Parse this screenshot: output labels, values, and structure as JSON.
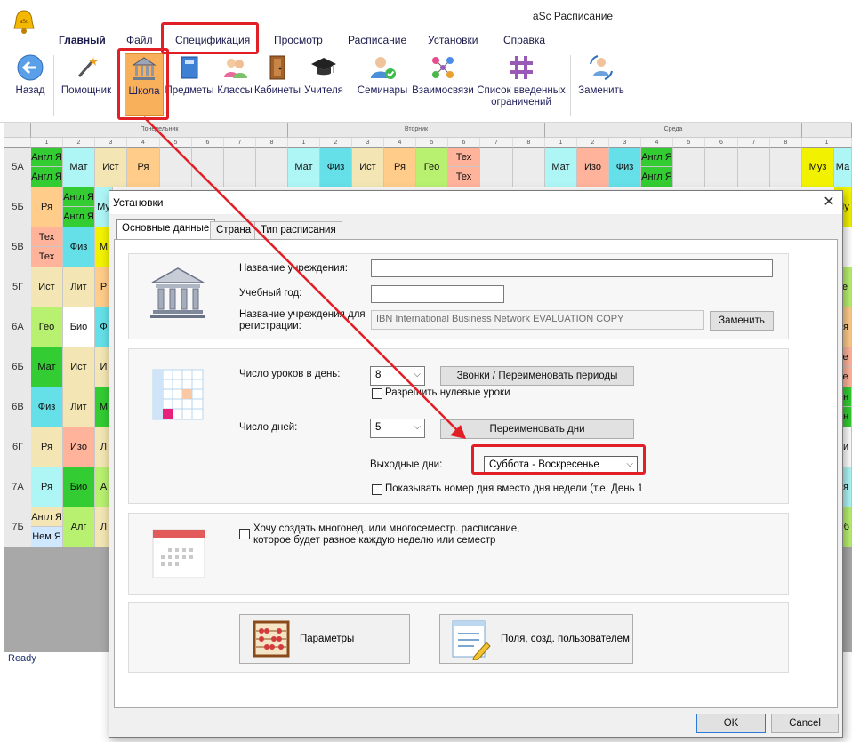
{
  "app": {
    "title": "aSc Расписание",
    "status": "Ready"
  },
  "menu": [
    "Главный",
    "Файл",
    "Спецификация",
    "Просмотр",
    "Расписание",
    "Установки",
    "Справка"
  ],
  "ribbon": {
    "back": "Назад",
    "wizard": "Помощник",
    "school": "Школа",
    "subjects": "Предметы",
    "classes": "Классы",
    "rooms": "Кабинеты",
    "teachers": "Учителя",
    "seminars": "Семинары",
    "relations": "Взаимосвязи",
    "constraints": "Список введенных ограничений",
    "replace": "Заменить"
  },
  "grid": {
    "days": [
      "Понедельник",
      "Вторник",
      "Среда"
    ],
    "periods": [
      "1",
      "2",
      "3",
      "4",
      "5",
      "6",
      "7",
      "8"
    ],
    "classes": [
      "5А",
      "5Б",
      "5В",
      "5Г",
      "6А",
      "6Б",
      "6В",
      "6Г",
      "7А",
      "7Б"
    ]
  },
  "lessons": {
    "r0": [
      "Англ Я",
      "Англ Я",
      "Мат",
      "Ист",
      "Ря",
      "Мат",
      "Физ",
      "Ист",
      "Ря",
      "Гео",
      "Тех",
      "Тех",
      "Мат",
      "Изо",
      "Физ",
      "Англ Я",
      "Англ Я",
      "Муз",
      "Ма"
    ],
    "r1": [
      "Ря",
      "Англ Я",
      "Англ Я",
      "Му",
      "Му"
    ],
    "r2": [
      "Тех",
      "Тех",
      "Физ",
      "М"
    ],
    "r3": [
      "Ист",
      "Лит",
      "Р",
      "Ге"
    ],
    "r4": [
      "Гео",
      "Био",
      "Ф",
      "Ря"
    ],
    "r5": [
      "Мат",
      "Ист",
      "И",
      "Те",
      "Те"
    ],
    "r6": [
      "Физ",
      "Лит",
      "М",
      "Ан",
      "Ан"
    ],
    "r7": [
      "Ря",
      "Изо",
      "Л",
      "Би"
    ],
    "r8": [
      "Ря",
      "Био",
      "А",
      "Ря"
    ],
    "r9": [
      "Англ Я",
      "Нем Я",
      "Алг",
      "Л",
      "Об"
    ]
  },
  "dialog": {
    "title": "Установки",
    "tabs": [
      "Основные данные",
      "Страна",
      "Тип расписания"
    ],
    "org_name_label": "Название учреждения:",
    "org_name_value": "",
    "year_label": "Учебный год:",
    "year_value": "",
    "reg_name_label": "Название учреждения для регистрации:",
    "reg_name_value": "IBN International Business Network EVALUATION COPY",
    "replace_button": "Заменить",
    "lessons_per_day_label": "Число уроков в день:",
    "lessons_per_day_value": "8",
    "bells_button": "Звонки / Переименовать периоды",
    "zero_lessons_label": "Разрешить нулевые уроки",
    "days_label": "Число дней:",
    "days_value": "5",
    "rename_days_button": "Переименовать дни",
    "weekend_label": "Выходные дни:",
    "weekend_value": "Суббота - Воскресенье",
    "show_day_number_label": "Показывать номер дня вместо дня недели (т.е. День 1",
    "multiweek_label": "Хочу создать многонед. или многосеместр. расписание, которое будет разное каждую неделю или семестр",
    "params_button": "Параметры",
    "user_fields_button": "Поля, созд. пользователем",
    "ok": "OK",
    "cancel": "Cancel"
  },
  "colors": {
    "annotation_red": "#e01f26",
    "green": "#33cc33",
    "sand": "#f3e6b4",
    "cyan": "#aef6f6",
    "orange": "#ffcc8a",
    "salmon": "#ffb39b",
    "lime": "#b8f070",
    "yellow": "#f2f200"
  }
}
